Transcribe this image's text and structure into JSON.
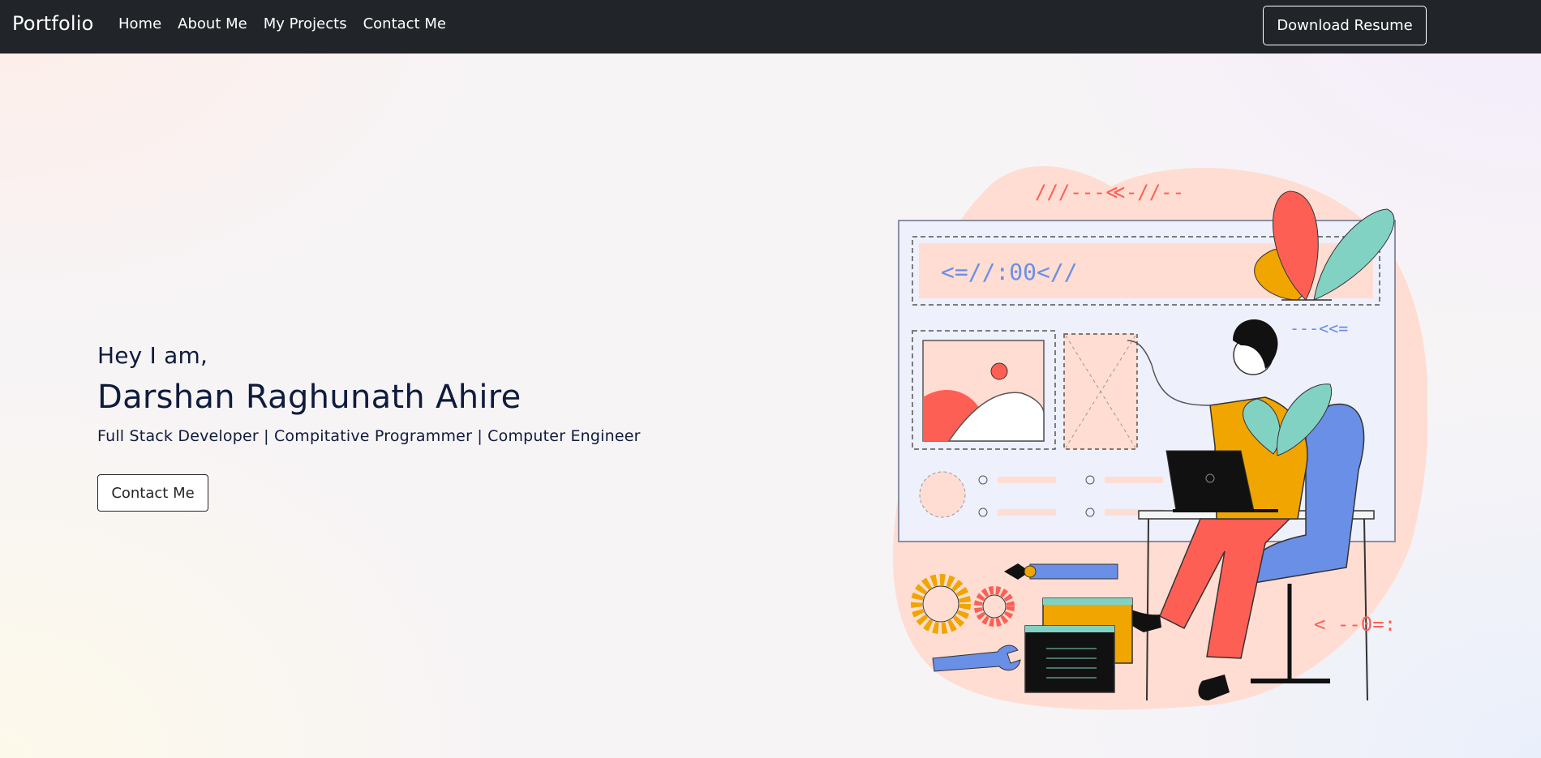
{
  "navbar": {
    "brand": "Portfolio",
    "links": [
      "Home",
      "About Me",
      "My Projects",
      "Contact Me"
    ],
    "resume_button": "Download Resume"
  },
  "hero": {
    "greeting": "Hey I am,",
    "name": "Darshan Raghunath Ahire",
    "tagline": "Full Stack Developer | Compitative Programmer | Computer Engineer",
    "contact_button": "Contact Me"
  },
  "illustration": {
    "description_icon": "developer-at-laptop-illustration",
    "glyphs": {
      "top": "///---≪-//--",
      "banner": "<=//:00<//",
      "right": "---<<=",
      "bottom_right": "< --0=:"
    }
  },
  "colors": {
    "navbar_bg": "#212529",
    "text_dark": "#0f1b3d",
    "blob": "#ffddd2",
    "accent_red": "#fe5f55",
    "accent_orange": "#f0a500",
    "accent_teal": "#82d2c4",
    "accent_blue": "#6a8fe6"
  }
}
